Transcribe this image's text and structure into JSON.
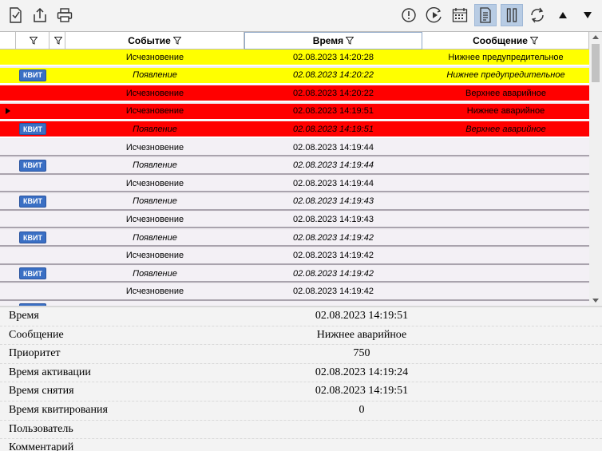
{
  "toolbar": {
    "left_icons": [
      "acknowledge-doc-icon",
      "export-icon",
      "print-icon"
    ],
    "right_icons": [
      "alert-circle-icon",
      "play-clock-icon",
      "calendar-icon",
      "document-icon",
      "pause-icon",
      "refresh-icon",
      "arrow-up-icon",
      "arrow-down-icon"
    ]
  },
  "grid": {
    "columns": [
      "Событие",
      "Время",
      "Сообщение"
    ],
    "ack_label": "КВИТ",
    "rows": [
      {
        "bg": "yellow",
        "kvit": false,
        "italic": false,
        "marker": false,
        "event": "Исчезновение",
        "time": "02.08.2023 14:20:28",
        "message": "Нижнее предупредительное"
      },
      {
        "bg": "yellow",
        "kvit": true,
        "italic": true,
        "marker": false,
        "event": "Появление",
        "time": "02.08.2023 14:20:22",
        "message": "Нижнее предупредительное"
      },
      {
        "bg": "red",
        "kvit": false,
        "italic": false,
        "marker": false,
        "event": "Исчезновение",
        "time": "02.08.2023 14:20:22",
        "message": "Верхнее аварийное"
      },
      {
        "bg": "red",
        "kvit": false,
        "italic": false,
        "marker": true,
        "event": "Исчезновение",
        "time": "02.08.2023 14:19:51",
        "message": "Нижнее аварийное"
      },
      {
        "bg": "red",
        "kvit": true,
        "italic": true,
        "marker": false,
        "event": "Появление",
        "time": "02.08.2023 14:19:51",
        "message": "Верхнее аварийное"
      },
      {
        "bg": "white",
        "kvit": false,
        "italic": false,
        "marker": false,
        "event": "Исчезновение",
        "time": "02.08.2023 14:19:44",
        "message": ""
      },
      {
        "bg": "white",
        "kvit": true,
        "italic": true,
        "marker": false,
        "event": "Появление",
        "time": "02.08.2023 14:19:44",
        "message": ""
      },
      {
        "bg": "white",
        "kvit": false,
        "italic": false,
        "marker": false,
        "event": "Исчезновение",
        "time": "02.08.2023 14:19:44",
        "message": ""
      },
      {
        "bg": "white",
        "kvit": true,
        "italic": true,
        "marker": false,
        "event": "Появление",
        "time": "02.08.2023 14:19:43",
        "message": ""
      },
      {
        "bg": "white",
        "kvit": false,
        "italic": false,
        "marker": false,
        "event": "Исчезновение",
        "time": "02.08.2023 14:19:43",
        "message": ""
      },
      {
        "bg": "white",
        "kvit": true,
        "italic": true,
        "marker": false,
        "event": "Появление",
        "time": "02.08.2023 14:19:42",
        "message": ""
      },
      {
        "bg": "white",
        "kvit": false,
        "italic": false,
        "marker": false,
        "event": "Исчезновение",
        "time": "02.08.2023 14:19:42",
        "message": ""
      },
      {
        "bg": "white",
        "kvit": true,
        "italic": true,
        "marker": false,
        "event": "Появление",
        "time": "02.08.2023 14:19:42",
        "message": ""
      },
      {
        "bg": "white",
        "kvit": false,
        "italic": false,
        "marker": false,
        "event": "Исчезновение",
        "time": "02.08.2023 14:19:42",
        "message": ""
      },
      {
        "bg": "white",
        "kvit": true,
        "italic": true,
        "marker": false,
        "event": "",
        "time": "",
        "message": ""
      }
    ]
  },
  "details": [
    {
      "label": "Время",
      "value": "02.08.2023 14:19:51"
    },
    {
      "label": "Сообщение",
      "value": "Нижнее аварийное"
    },
    {
      "label": "Приоритет",
      "value": "750"
    },
    {
      "label": "Время активации",
      "value": "02.08.2023 14:19:24"
    },
    {
      "label": "Время снятия",
      "value": "02.08.2023 14:19:51"
    },
    {
      "label": "Время квитирования",
      "value": "0"
    },
    {
      "label": "Пользователь",
      "value": ""
    },
    {
      "label": "Комментарий",
      "value": ""
    }
  ],
  "colors": {
    "yellow": "#ffff00",
    "red": "#ff0000",
    "white": "#f3f0f5",
    "active_button": "#b8cce4",
    "kvit_button": "#3a6fc4"
  }
}
